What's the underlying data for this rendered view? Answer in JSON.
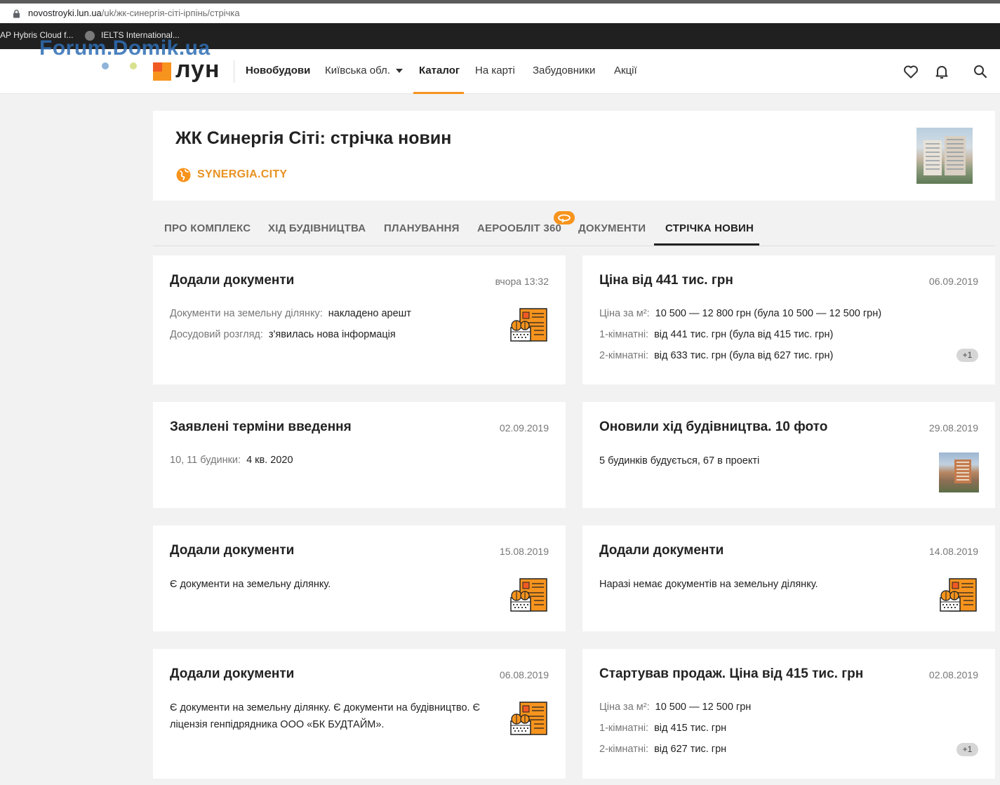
{
  "browser": {
    "url_host": "novostroyki.lun.ua",
    "url_path": "/uk/жк-синергія-сіті-ірпінь/стрічка",
    "bookmarks": [
      "AP Hybris Cloud f...",
      "IELTS International..."
    ]
  },
  "watermark": "Forum.Domik.ua",
  "header": {
    "logo": "ЛУН",
    "nav": {
      "new_buildings": "Новобудови",
      "region": "Київська обл.",
      "catalog": "Каталог",
      "map": "На карті",
      "developers": "Забудовники",
      "promos": "Акції"
    },
    "icons": [
      "heart-icon",
      "bell-icon",
      "search-icon"
    ]
  },
  "complex": {
    "title": "ЖК Синергія Сіті: стрічка новин",
    "site": "SYNERGIA.CITY"
  },
  "tabs": {
    "about": "ПРО КОМПЛЕКС",
    "progress": "ХІД БУДІВНИЦТВА",
    "plans": "ПЛАНУВАННЯ",
    "aerial": "АЕРООБЛІТ 360",
    "documents": "ДОКУМЕНТИ",
    "news": "СТРІЧКА НОВИН"
  },
  "cards": {
    "c1": {
      "title": "Додали документи",
      "date": "вчора 13:32",
      "r1_label": "Документи на земельну ділянку:",
      "r1_value": "накладено арешт",
      "r2_label": "Досудовий розгляд:",
      "r2_value": "з'явилась нова інформація"
    },
    "c2": {
      "title": "Ціна від 441 тис. грн",
      "date": "06.09.2019",
      "r1_label": "Ціна за м²:",
      "r1_value": "10 500 — 12 800 грн (була 10 500 — 12 500 грн)",
      "r2_label": "1-кімнатні:",
      "r2_value": "від 441 тис. грн (була від 415 тис. грн)",
      "r3_label": "2-кімнатні:",
      "r3_value": "від 633 тис. грн (була від 627 тис. грн)",
      "more": "+1"
    },
    "c3": {
      "title": "Заявлені терміни введення",
      "date": "02.09.2019",
      "r1_label": "10, 11 будинки:",
      "r1_value": "4 кв. 2020"
    },
    "c4": {
      "title": "Оновили хід будівництва. 10 фото",
      "date": "29.08.2019",
      "text": "5 будинків будується, 67 в проекті"
    },
    "c5": {
      "title": "Додали документи",
      "date": "15.08.2019",
      "text": "Є документи на земельну ділянку."
    },
    "c6": {
      "title": "Додали документи",
      "date": "14.08.2019",
      "text": "Наразі немає документів на земельну ділянку."
    },
    "c7": {
      "title": "Додали документи",
      "date": "06.08.2019",
      "text": "Є документи на земельну ділянку. Є документи на будівництво. Є ліцензія генпідрядника ООО «БК БУДТАЙМ»."
    },
    "c8": {
      "title": "Стартував продаж. Ціна від 415 тис. грн",
      "date": "02.08.2019",
      "r1_label": "Ціна за м²:",
      "r1_value": "10 500 — 12 500 грн",
      "r2_label": "1-кімнатні:",
      "r2_value": "від 415 тис. грн",
      "r3_label": "2-кімнатні:",
      "r3_value": "від 627 тис. грн",
      "more": "+1"
    }
  },
  "colors": {
    "accent": "#f7941d",
    "link": "#e89222",
    "page_bg": "#f2f2f2"
  }
}
